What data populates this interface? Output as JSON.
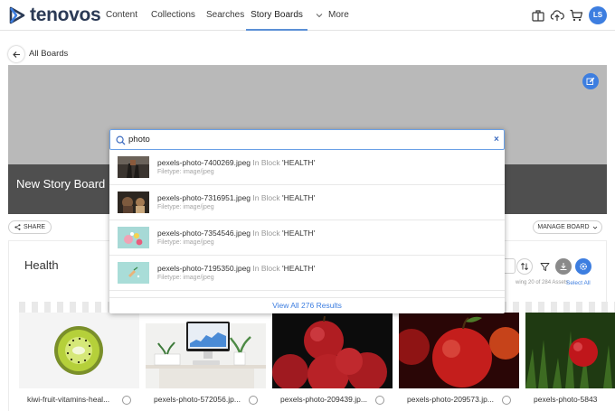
{
  "brand": {
    "name": "tenovos",
    "accent": "#3d7ee0",
    "logo_color": "#2b3a55"
  },
  "nav": {
    "items": [
      {
        "label": "Content",
        "active": false
      },
      {
        "label": "Collections",
        "active": false
      },
      {
        "label": "Searches",
        "active": false
      },
      {
        "label": "Story Boards",
        "active": true
      }
    ],
    "more_label": "More",
    "icons": [
      "briefcase-icon",
      "upload-cloud-icon",
      "cart-icon"
    ],
    "user_initials": "LS"
  },
  "subheader": {
    "back_label": "All Boards"
  },
  "board": {
    "title": "New Story Board",
    "share_label": "SHARE",
    "manage_label": "MANAGE BOARD"
  },
  "section": {
    "title": "Health",
    "showing_text": "wing 20 of 284 Assets",
    "select_all_label": "Select All"
  },
  "assets": [
    {
      "name": "kiwi-fruit-vitamins-heal..."
    },
    {
      "name": "pexels-photo-572056.jp..."
    },
    {
      "name": "pexels-photo-209439.jp..."
    },
    {
      "name": "pexels-photo-209573.jp..."
    },
    {
      "name": "pexels-photo-5843"
    }
  ],
  "search": {
    "query": "photo",
    "clear_label": "×",
    "results": [
      {
        "filename": "pexels-photo-7400269.jpeg",
        "in_block": "In Block",
        "block": "'HEALTH'",
        "filetype": "Filetype: image/jpeg"
      },
      {
        "filename": "pexels-photo-7316951.jpeg",
        "in_block": "In Block",
        "block": "'HEALTH'",
        "filetype": "Filetype: image/jpeg"
      },
      {
        "filename": "pexels-photo-7354546.jpeg",
        "in_block": "In Block",
        "block": "'HEALTH'",
        "filetype": "Filetype: image/jpeg"
      },
      {
        "filename": "pexels-photo-7195350.jpeg",
        "in_block": "In Block",
        "block": "'HEALTH'",
        "filetype": "Filetype: image/jpeg"
      }
    ],
    "view_all_label": "View All 276 Results"
  }
}
